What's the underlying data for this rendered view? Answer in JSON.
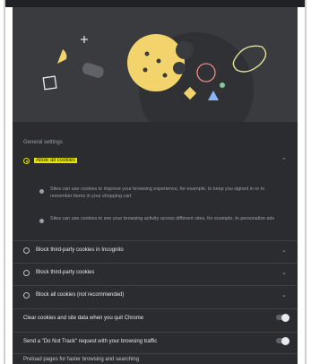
{
  "section_heading": "General settings",
  "options": [
    {
      "label": "Allow all cookies",
      "selected": true
    },
    {
      "label": "Block third-party cookies in Incognito",
      "selected": false
    },
    {
      "label": "Block third-party cookies",
      "selected": false
    },
    {
      "label": "Block all cookies (not recommended)",
      "selected": false
    }
  ],
  "allow_details": [
    "Sites can use cookies to improve your browsing experience, for example, to keep you signed in or to remember items in your shopping cart",
    "Sites can use cookies to see your browsing activity across different sites, for example, to personalize ads"
  ],
  "toggles": [
    {
      "label": "Clear cookies and site data when you quit Chrome",
      "on": false
    },
    {
      "label": "Send a \"Do Not Track\" request with your browsing traffic",
      "on": false
    }
  ],
  "partial_text": "Preload pages for faster browsing and searching",
  "colors": {
    "panel": "#2b2c2f",
    "accent": "#e6e600",
    "cookie": "#f3d36b"
  }
}
